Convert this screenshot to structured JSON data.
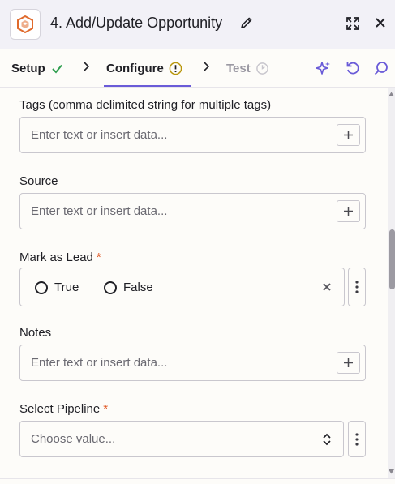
{
  "header": {
    "title": "4. Add/Update Opportunity",
    "app_icon": "app-logo-icon",
    "edit_icon": "pencil-icon",
    "expand_icon": "expand-icon",
    "close_icon": "close-icon"
  },
  "tabs": [
    {
      "label": "Setup",
      "status_icon": "checkmark-icon",
      "state": "done"
    },
    {
      "label": "Configure",
      "status_icon": "warning-icon",
      "state": "active"
    },
    {
      "label": "Test",
      "status_icon": "clock-icon",
      "state": "disabled"
    }
  ],
  "toolbar": {
    "ai_icon": "sparkle-icon",
    "refresh_icon": "refresh-icon",
    "search_icon": "search-icon"
  },
  "form": {
    "tags": {
      "label": "Tags (comma delimited string for multiple tags)",
      "placeholder": "Enter text or insert data..."
    },
    "source": {
      "label": "Source",
      "placeholder": "Enter text or insert data..."
    },
    "mark_as_lead": {
      "label": "Mark as Lead",
      "required_mark": "*",
      "options": [
        "True",
        "False"
      ]
    },
    "notes": {
      "label": "Notes",
      "placeholder": "Enter text or insert data..."
    },
    "select_pipeline": {
      "label": "Select Pipeline",
      "required_mark": "*",
      "placeholder": "Choose value..."
    }
  },
  "colors": {
    "accent": "#6a5bd8",
    "required": "#e0541f",
    "success": "#2e9e4f",
    "warning": "#b8960a",
    "logo": "#e06a2c"
  }
}
